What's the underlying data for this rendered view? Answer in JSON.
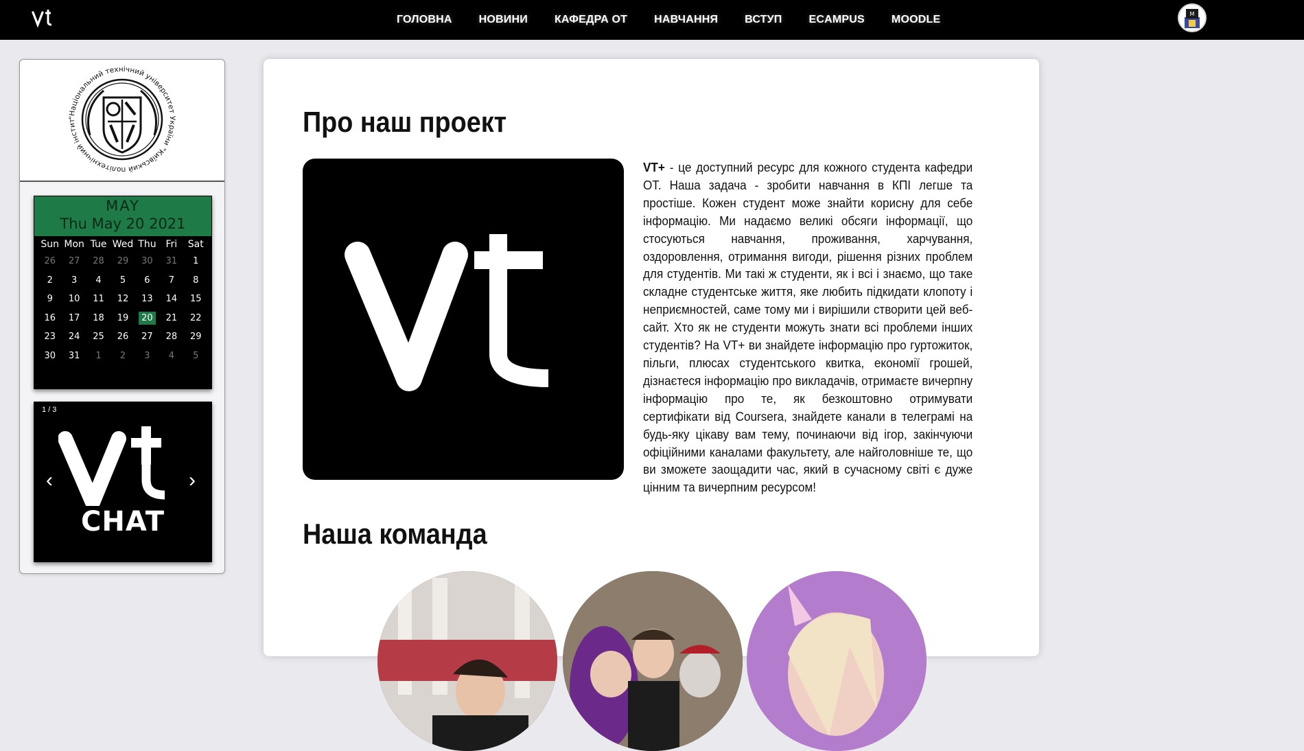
{
  "header": {
    "logo_icon": "vt-logo",
    "nav": [
      "ГОЛОВНА",
      "НОВИНИ",
      "КАФЕДРА ОТ",
      "НАВЧАННЯ",
      "ВСТУП",
      "ECAMPUS",
      "MOODLE"
    ],
    "avatar_icon": "user-avatar"
  },
  "sidebar": {
    "emblem_text": "\"Національний технічний університет України \"Київський політехнічний інститут\"",
    "calendar": {
      "month": "MAY",
      "date": "Thu May 20 2021",
      "weekdays": [
        "Sun",
        "Mon",
        "Tue",
        "Wed",
        "Thu",
        "Fri",
        "Sat"
      ],
      "days": [
        "26",
        "27",
        "28",
        "29",
        "30",
        "31",
        "1",
        "2",
        "3",
        "4",
        "5",
        "6",
        "7",
        "8",
        "9",
        "10",
        "11",
        "12",
        "13",
        "14",
        "15",
        "16",
        "17",
        "18",
        "19",
        "20",
        "21",
        "22",
        "23",
        "24",
        "25",
        "26",
        "27",
        "28",
        "29",
        "30",
        "31",
        "1",
        "2",
        "3",
        "4",
        "5"
      ],
      "today": "20"
    },
    "carousel": {
      "counter": "1 / 3",
      "prev": "‹",
      "next": "›",
      "slide_caption": "CHAT"
    }
  },
  "main": {
    "about_title": "Про наш проект",
    "about_lead": "VT+",
    "about_body": " - це доступний ресурс для кожного студента кафедри ОТ. Наша задача - зробити навчання в КПІ легше та простіше. Кожен студент може знайти корисну для себе інформацію. Ми надаємо великі обсяги інформації, що стосуються навчання, проживання, харчування, оздоровлення, отримання вигоди, рішення різних проблем для студентів. Ми такі ж студенти, як і всі і знаємо, що таке складне студентське життя, яке любить підкидати клопоту і неприємностей, саме тому ми і вирішили створити цей веб-сайт. Хто як не студенти можуть знати всі проблеми інших студентів? На VT+ ви знайдете інформацію про гуртожиток, пільги, плюсах студентського квитка, економії грошей, дізнаєтеся інформацію про викладачів, отримаєте вичерпну інформацію про те, як безкоштовно отримувати сертифікати від Coursera, знайдете канали в телеграмі на будь-яку цікаву вам тему, починаючи від ігор, закінчуючи офіційними каналами факультету, але найголовніше те, що ви зможете заощадити час, який в сучасному світі є дуже цінним та вичерпним ресурсом!",
    "team_title": "Наша команда",
    "team_photos": [
      "team-member-photo-1",
      "team-member-photo-2",
      "team-member-photo-3"
    ]
  },
  "colors": {
    "accent_green": "#1e7a47",
    "topbar": "#000000",
    "background": "#e9e9ee"
  }
}
